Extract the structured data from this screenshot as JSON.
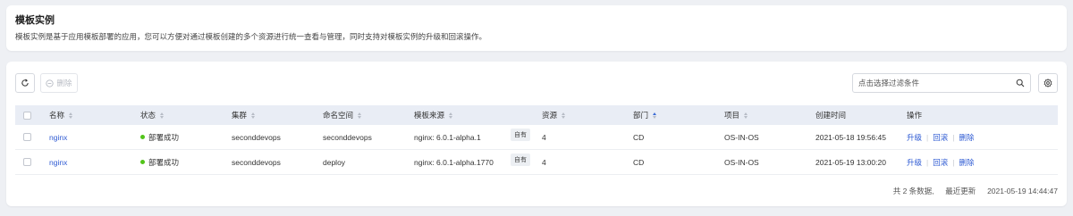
{
  "header": {
    "title": "模板实例",
    "description": "模板实例是基于应用模板部署的应用，您可以方便对通过模板创建的多个资源进行统一查看与管理，同时支持对模板实例的升级和回滚操作。"
  },
  "toolbar": {
    "delete_label": "删除",
    "filter_placeholder": "点击选择过滤条件"
  },
  "table": {
    "columns": [
      "名称",
      "状态",
      "集群",
      "命名空间",
      "模板来源",
      "资源",
      "部门",
      "项目",
      "创建时间",
      "操作"
    ],
    "rows": [
      {
        "name": "nginx",
        "status": "部署成功",
        "cluster": "seconddevops",
        "namespace": "seconddevops",
        "source": "nginx: 6.0.1-alpha.1",
        "source_tag": "自有",
        "resources": "4",
        "department": "CD",
        "project": "OS-IN-OS",
        "created": "2021-05-18 19:56:45",
        "actions": [
          "升级",
          "回滚",
          "删除"
        ]
      },
      {
        "name": "nginx",
        "status": "部署成功",
        "cluster": "seconddevops",
        "namespace": "deploy",
        "source": "nginx: 6.0.1-alpha.1770",
        "source_tag": "自有",
        "resources": "4",
        "department": "CD",
        "project": "OS-IN-OS",
        "created": "2021-05-19 13:00:20",
        "actions": [
          "升级",
          "回滚",
          "删除"
        ]
      }
    ]
  },
  "footer": {
    "total": "共 2 条数据,",
    "updated_label": "最近更新",
    "updated_time": "2021-05-19 14:44:47"
  },
  "colors": {
    "status_success": "#52c41a",
    "link": "#2f5bd3",
    "header_bg": "#e9edf5"
  },
  "icons": {
    "refresh": "refresh-icon",
    "delete": "minus-circle-icon",
    "search": "search-icon",
    "settings": "gear-icon"
  }
}
